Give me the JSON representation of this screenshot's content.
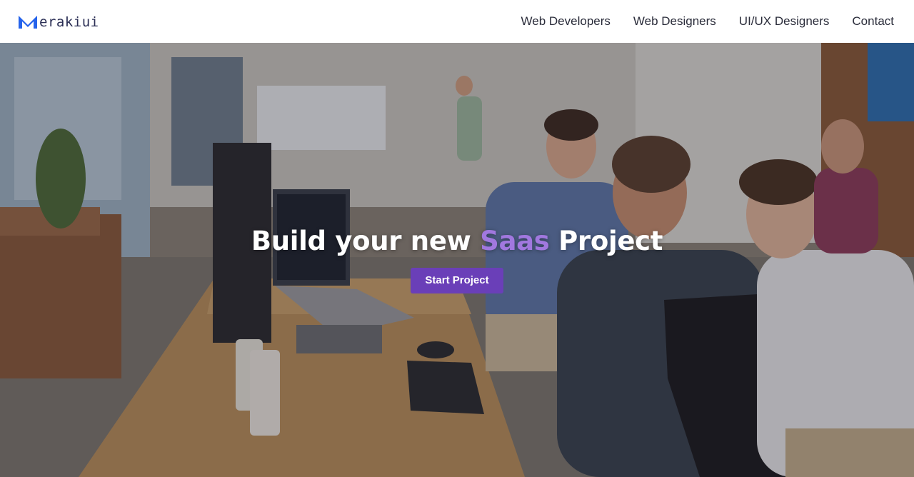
{
  "brand": {
    "name": "erakiui",
    "logo_icon": "M-chevron-logo-icon"
  },
  "nav": {
    "links": [
      {
        "label": "Web Developers"
      },
      {
        "label": "Web Designers"
      },
      {
        "label": "UI/UX Designers"
      },
      {
        "label": "Contact"
      }
    ]
  },
  "hero": {
    "title_before": "Build your new ",
    "title_accent": "Saas",
    "title_after": " Project",
    "cta_label": "Start Project",
    "photo": "office-team-meeting-photo"
  },
  "colors": {
    "accent": "#a178df",
    "button": "#6a3fb8",
    "logo_blue": "#2563eb",
    "logo_text": "#2b2f55"
  }
}
